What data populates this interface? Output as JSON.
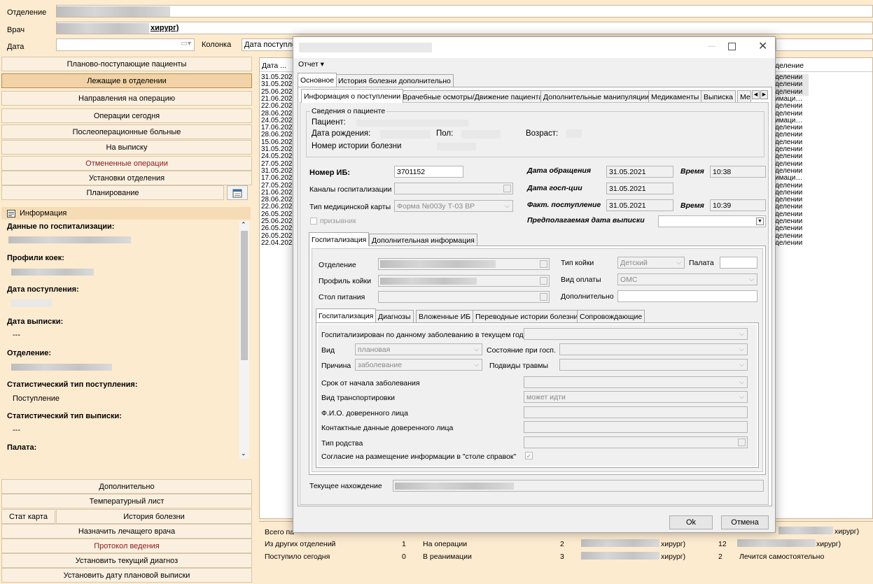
{
  "filters": {
    "department_label": "Отделение",
    "doctor_label": "Врач",
    "doctor_value": "хирург)",
    "date_label": "Дата",
    "column_label": "Колонка",
    "column_value": "Дата поступлен"
  },
  "nav": {
    "items": [
      "Планово-поступающие пациенты",
      "Лежащие в отделении",
      "Направления на операцию",
      "Операции сегодня",
      "Послеоперационные больные",
      "На выписку",
      "Отмененные операции",
      "Установки отделения",
      "Планирование"
    ],
    "bottom": [
      "Дополнительно",
      "Температурный лист",
      "Стат карта",
      "История болезни",
      "Назначить лечащего врача",
      "Протокол ведения",
      "Установить текущий диагноз",
      "Установить дату плановой выписки"
    ]
  },
  "info": {
    "header": "Информация",
    "hosp_data": "Данные по госпитализации:",
    "bed_profiles": "Профили коек:",
    "admission_date": "Дата поступления:",
    "discharge_date": "Дата выписки:",
    "discharge_value": "---",
    "department": "Отделение:",
    "stat_admission_type": "Статистический тип поступления:",
    "stat_admission_value": "Поступление",
    "stat_discharge_type": "Статистический тип выписки:",
    "stat_discharge_value": "---",
    "ward": "Палата:"
  },
  "grid": {
    "col_date": "Дата ...",
    "col_dept": "деление",
    "dates": [
      "31.05.202",
      "31.05.202",
      "25.06.202",
      "21.06.202",
      "22.06.202",
      "28.06.202",
      "24.05.202",
      "17.06.202",
      "28.06.202",
      "15.06.202",
      "31.05.202",
      "24.05.202",
      "27.05.202",
      "31.05.202",
      "17.06.202",
      "27.05.202",
      "21.06.202",
      "28.06.202",
      "22.06.202",
      "26.05.202",
      "25.06.202",
      "26.05.202",
      "26.05.202",
      "22.04.202"
    ],
    "depts": [
      "делении",
      "делении",
      "делении",
      "имаци…",
      "делении",
      "делении",
      "имаци…",
      "делении",
      "делении",
      "делении",
      "делении",
      "делении",
      "делении",
      "делении",
      "имаци…",
      "делении",
      "делении",
      "делении",
      "делении",
      "делении",
      "делении",
      "делении",
      "делении",
      "делении"
    ]
  },
  "stats": {
    "total_label": "Всего па",
    "from_other": "Из других отделений",
    "from_other_n": "1",
    "admitted_today": "Поступило сегодня",
    "admitted_today_n": "0",
    "on_surgery": "На операции",
    "on_surgery_n": "2",
    "in_icu": "В реанимации",
    "in_icu_n": "3",
    "surgeon": "хирург)",
    "n12": "12",
    "n2": "2",
    "self_treat": "Лечится самостоятельно"
  },
  "dialog": {
    "menu_report": "Отчет ▾",
    "tabs_top": [
      "Основное",
      "История болезни дополнительно"
    ],
    "tabs_main": [
      "Информация о поступлении",
      "Врачебные осмотры/Движение пациента",
      "Дополнительные манипуляции",
      "Медикаменты",
      "Выписка",
      "Ме"
    ],
    "patient_box": "Сведения о пациенте",
    "patient_label": "Пациент:",
    "birth_label": "Дата рождения:",
    "sex_label": "Пол:",
    "age_label": "Возраст:",
    "history_label": "Номер истории болезни",
    "ib_label": "Номер ИБ:",
    "ib_value": "3701152",
    "appeal_label": "Дата обращения",
    "appeal_value": "31.05.2021",
    "time_label": "Время",
    "appeal_time": "10:38",
    "channels_label": "Каналы госпитализации",
    "hosp_date_label": "Дата госп-ции",
    "hosp_date_value": "31.05.2021",
    "card_type_label": "Тип медицинской карты",
    "card_type_value": "Форма №003у Т-03 ВР",
    "fact_label": "Факт. поступление",
    "fact_value": "31.05.2021",
    "fact_time": "10:39",
    "conscript_label": "призывник",
    "expected_label": "Предполагаемая дата выписки",
    "tabs_sub": [
      "Госпитализация",
      "Дополнительная информация"
    ],
    "dept_label": "Отделение",
    "bed_type_label": "Тип койки",
    "bed_type_value": "Детский",
    "ward_label": "Палата",
    "bed_profile_label": "Профиль койки",
    "payment_label": "Вид оплаты",
    "payment_value": "ОМС",
    "diet_label": "Стол питания",
    "extra_label": "Дополнительно",
    "tabs_inner": [
      "Госпитализация",
      "Диагнозы",
      "Вложенные ИБ",
      "Переводные истории болезни",
      "Сопровождающие"
    ],
    "hosp_this_year": "Госпитализирован по данному заболеванию в текущем году",
    "kind_label": "Вид",
    "kind_value": "плановая",
    "state_label": "Состояние при госп.",
    "reason_label": "Причина",
    "reason_value": "заболевание",
    "trauma_label": "Подвиды травмы",
    "onset_label": "Срок от начала заболевания",
    "transport_label": "Вид транспортировки",
    "transport_value": "может идти",
    "trustee_name": "Ф.И.О. доверенного лица",
    "trustee_contacts": "Контактные данные доверенного лица",
    "relation_label": "Тип родства",
    "consent_label": "Согласие на размещение информации в \"столе справок\"",
    "current_location": "Текущее нахождение",
    "ok": "Ok",
    "cancel": "Отмена"
  }
}
